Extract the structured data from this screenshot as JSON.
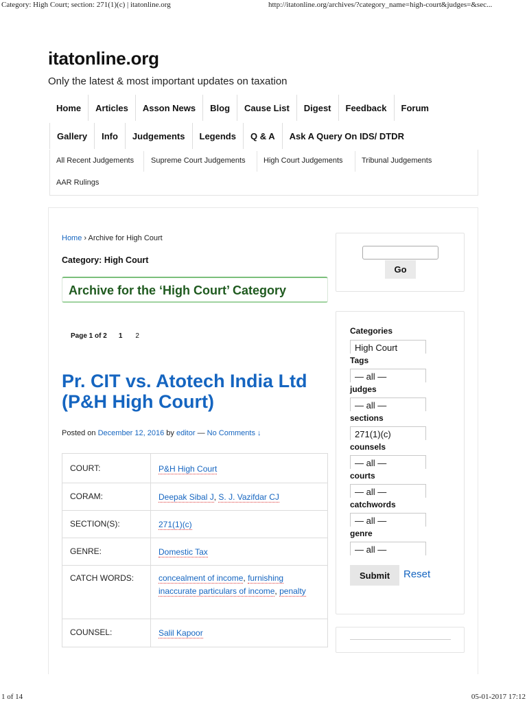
{
  "print": {
    "header_left": "Category: High Court; section: 271(1)(c) | itatonline.org",
    "header_right": "http://itatonline.org/archives/?category_name=high-court&judges=&sec...",
    "footer_left": "1 of 14",
    "footer_right": "05-01-2017 17:12"
  },
  "site": {
    "title": "itatonline.org",
    "tagline": "Only the latest & most important updates on taxation"
  },
  "nav": {
    "row1": [
      "Home",
      "Articles",
      "Asson News",
      "Blog",
      "Cause List",
      "Digest",
      "Feedback",
      "Forum"
    ],
    "row2": [
      "Gallery",
      "Info",
      "Judgements",
      "Legends",
      "Q & A",
      "Ask A Query On IDS/ DTDR"
    ]
  },
  "subnav": [
    "All Recent Judgements",
    "Supreme Court Judgements",
    "High Court Judgements",
    "Tribunal Judgements",
    "AAR Rulings"
  ],
  "breadcrumb": {
    "home": "Home",
    "sep": "›",
    "current": "Archive for High Court"
  },
  "category_label": "Category: High Court",
  "archive_heading": "Archive for the ‘High Court’ Category",
  "pager": {
    "info": "Page 1 of 2",
    "current": "1",
    "next": "2"
  },
  "post": {
    "title": "Pr. CIT vs. Atotech India Ltd (P&H High Court)",
    "meta": {
      "posted_on": "Posted on",
      "date": "December 12, 2016",
      "by": "by",
      "author": "editor",
      "dash": "—",
      "comments": "No Comments ↓"
    },
    "table": {
      "court_k": "COURT:",
      "court_v": "P&H High Court",
      "coram_k": "CORAM:",
      "coram_v1": "Deepak Sibal J",
      "coram_v2": "S. J. Vazifdar CJ",
      "section_k": "SECTION(S):",
      "section_v": "271(1)(c)",
      "genre_k": "GENRE:",
      "genre_v": "Domestic Tax",
      "catch_k": "CATCH WORDS:",
      "catch_v1": "concealment of income",
      "catch_v2": "furnishing inaccurate particulars of income",
      "catch_v3": "penalty",
      "counsel_k": "COUNSEL:",
      "counsel_v": "Salil Kapoor"
    }
  },
  "sidebar": {
    "search_value": "",
    "go_label": "Go",
    "filters": {
      "categories_label": "Categories",
      "categories_value": "High Court",
      "tags_label": "Tags",
      "tags_value": "— all —",
      "judges_label": "judges",
      "judges_value": "— all —",
      "sections_label": "sections",
      "sections_value": "271(1)(c)",
      "counsels_label": "counsels",
      "counsels_value": "— all —",
      "courts_label": "courts",
      "courts_value": "— all —",
      "catchwords_label": "catchwords",
      "catchwords_value": "— all —",
      "genre_label": "genre",
      "genre_value": "— all —"
    },
    "submit_label": "Submit",
    "reset_label": "Reset"
  },
  "colors": {
    "link": "#1565c0",
    "archive_heading": "#1f5a1f",
    "archive_border": "#7bbf7b"
  }
}
